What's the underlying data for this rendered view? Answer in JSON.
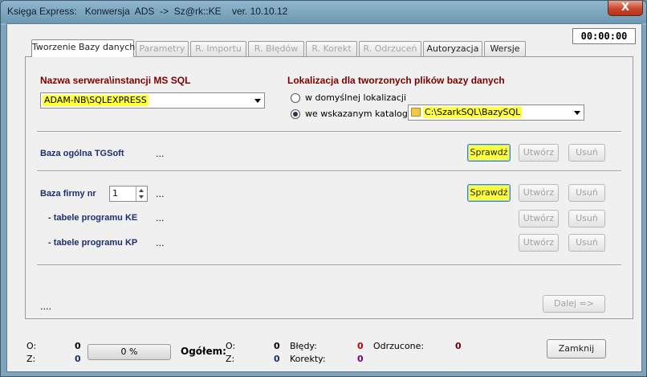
{
  "window": {
    "title": "Księga Express:   Konwersja  ADS  ->  Sz@rk::KE    ver. 10.10.12",
    "close_label": "X"
  },
  "timer": "00:00:00",
  "tabs": [
    {
      "label": "Tworzenie Bazy danych",
      "state": "active"
    },
    {
      "label": "Parametry",
      "state": "disabled"
    },
    {
      "label": "R. Importu",
      "state": "disabled"
    },
    {
      "label": "R. Błędów",
      "state": "disabled"
    },
    {
      "label": "R. Korekt",
      "state": "disabled"
    },
    {
      "label": "R. Odrzuceń",
      "state": "disabled"
    },
    {
      "label": "Autoryzacja",
      "state": "enabled"
    },
    {
      "label": "Wersje",
      "state": "enabled"
    }
  ],
  "server": {
    "label": "Nazwa serwera\\instancji  MS SQL",
    "value": "ADAM-NB\\SQLEXPRESS"
  },
  "location": {
    "label": "Lokalizacja dla tworzonych plików bazy danych",
    "option_default": "w domyślnej lokalizacji",
    "option_custom": "we wskazanym katalogu:",
    "path": "C:\\SzarkSQL\\BazySQL",
    "selected": "custom"
  },
  "general": {
    "label": "Baza ogólna TGSoft",
    "status": "...",
    "check": "Sprawdź",
    "create": "Utwórz",
    "delete": "Usuń"
  },
  "company": {
    "label": "Baza firmy nr",
    "number": "1",
    "status": "...",
    "check": "Sprawdź",
    "create": "Utwórz",
    "delete": "Usuń",
    "ke_label": "- tabele programu KE",
    "ke_status": "...",
    "ke_create": "Utwórz",
    "ke_delete": "Usuń",
    "kp_label": "- tabele programu KP",
    "kp_status": "...",
    "kp_create": "Utwórz",
    "kp_delete": "Usuń"
  },
  "footer_status": "....",
  "next_button": "Dalej =>",
  "stats": {
    "o_label": "O:",
    "o_value": "0",
    "z_label": "Z:",
    "z_value": "0",
    "progress": "0 %",
    "total_label": "Ogółem:",
    "total_o_label": "O:",
    "total_o_value": "0",
    "total_z_label": "Z:",
    "total_z_value": "0",
    "errors_label": "Błędy:",
    "errors_value": "0",
    "corrections_label": "Korekty:",
    "corrections_value": "0",
    "rejected_label": "Odrzucone:",
    "rejected_value": "0"
  },
  "close_button": "Zamknij",
  "colors": {
    "highlight": "#ffff3a",
    "label_red": "#7a0000",
    "label_blue": "#1c2f6e",
    "errors": "#c00000",
    "corrections": "#7a0080"
  }
}
